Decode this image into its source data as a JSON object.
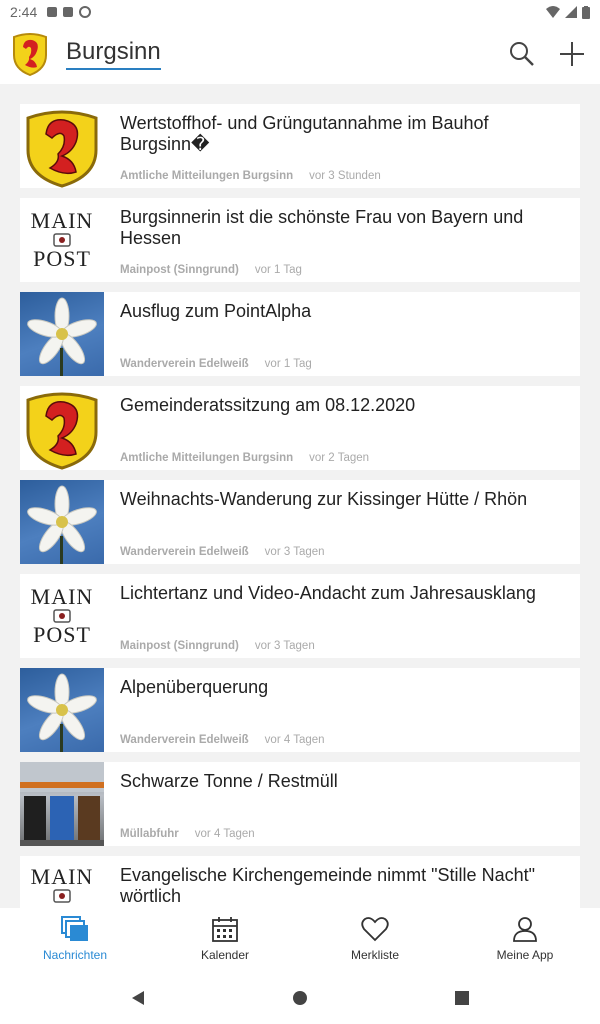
{
  "status_bar": {
    "time": "2:44"
  },
  "app_bar": {
    "title": "Burgsinn",
    "search_icon": "search-icon",
    "add_icon": "plus-icon"
  },
  "colors": {
    "accent": "#2a8ad4",
    "underline": "#2a7fc1",
    "meta_text": "#aaaaaa"
  },
  "feed": [
    {
      "headline": "Wertstoffhof- und Grüngutannahme im Bauhof Burgsinn�",
      "source": "Amtliche Mitteilungen Burgsinn",
      "time": "vor 3 Stunden",
      "thumb": "coat-of-arms"
    },
    {
      "headline": "Burgsinnerin ist die schönste Frau von Bayern und Hessen",
      "source": "Mainpost (Sinngrund)",
      "time": "vor 1 Tag",
      "thumb": "mainpost",
      "thumb_text": [
        "MAIN",
        "POST"
      ]
    },
    {
      "headline": "Ausflug zum PointAlpha",
      "source": "Wanderverein Edelweiß",
      "time": "vor 1 Tag",
      "thumb": "edelweiss"
    },
    {
      "headline": "Gemeinderatssitzung am 08.12.2020",
      "source": "Amtliche Mitteilungen Burgsinn",
      "time": "vor 2 Tagen",
      "thumb": "coat-of-arms"
    },
    {
      "headline": "Weihnachts-Wanderung zur Kissinger Hütte / Rhön",
      "source": "Wanderverein Edelweiß",
      "time": "vor 3 Tagen",
      "thumb": "edelweiss"
    },
    {
      "headline": "Lichtertanz und Video-Andacht zum Jahresausklang",
      "source": "Mainpost (Sinngrund)",
      "time": "vor 3 Tagen",
      "thumb": "mainpost",
      "thumb_text": [
        "MAIN",
        "POST"
      ]
    },
    {
      "headline": "Alpenüberquerung",
      "source": "Wanderverein Edelweiß",
      "time": "vor 4 Tagen",
      "thumb": "edelweiss"
    },
    {
      "headline": "Schwarze Tonne / Restmüll",
      "source": "Müllabfuhr",
      "time": "vor 4 Tagen",
      "thumb": "bins"
    },
    {
      "headline": "Evangelische Kirchengemeinde nimmt \"Stille Nacht\" wörtlich",
      "source": "",
      "time": "",
      "thumb": "mainpost",
      "thumb_text": [
        "MAIN",
        ""
      ]
    }
  ],
  "bottom_nav": [
    {
      "label": "Nachrichten",
      "icon": "news-icon",
      "active": true
    },
    {
      "label": "Kalender",
      "icon": "calendar-icon",
      "active": false
    },
    {
      "label": "Merkliste",
      "icon": "heart-icon",
      "active": false
    },
    {
      "label": "Meine App",
      "icon": "person-icon",
      "active": false
    }
  ]
}
